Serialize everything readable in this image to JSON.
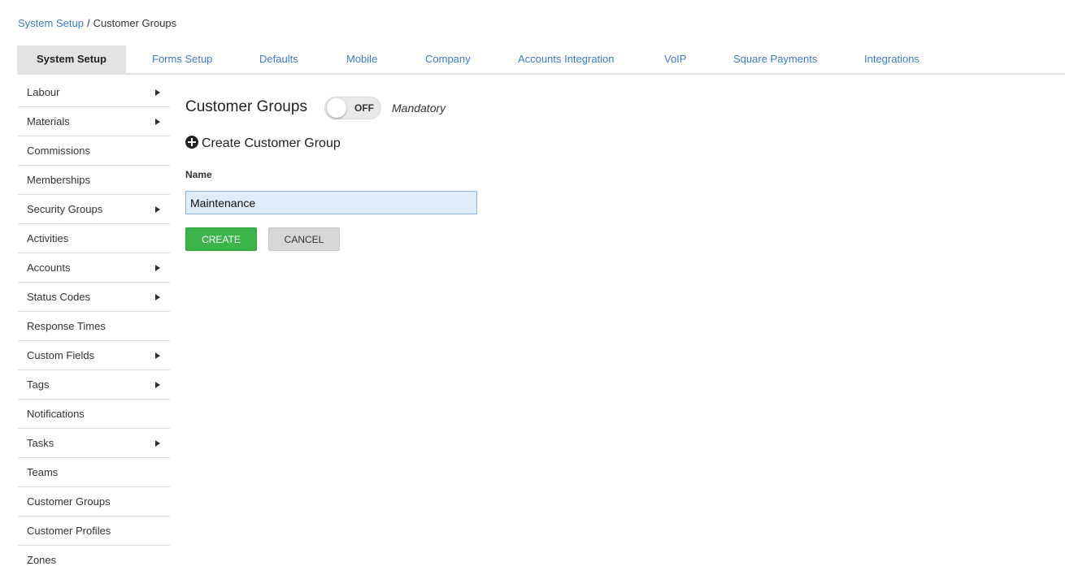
{
  "breadcrumb": {
    "parent": "System Setup",
    "separator": "/",
    "current": "Customer Groups"
  },
  "tabs": [
    {
      "label": "System Setup",
      "active": true
    },
    {
      "label": "Forms Setup"
    },
    {
      "label": "Defaults"
    },
    {
      "label": "Mobile"
    },
    {
      "label": "Company"
    },
    {
      "label": "Accounts Integration"
    },
    {
      "label": "VoIP"
    },
    {
      "label": "Square Payments"
    },
    {
      "label": "Integrations"
    }
  ],
  "sidebar": {
    "items": [
      {
        "label": "Labour",
        "has_submenu": true
      },
      {
        "label": "Materials",
        "has_submenu": true
      },
      {
        "label": "Commissions",
        "has_submenu": false
      },
      {
        "label": "Memberships",
        "has_submenu": false
      },
      {
        "label": "Security Groups",
        "has_submenu": true
      },
      {
        "label": "Activities",
        "has_submenu": false
      },
      {
        "label": "Accounts",
        "has_submenu": true
      },
      {
        "label": "Status Codes",
        "has_submenu": true
      },
      {
        "label": "Response Times",
        "has_submenu": false
      },
      {
        "label": "Custom Fields",
        "has_submenu": true
      },
      {
        "label": "Tags",
        "has_submenu": true
      },
      {
        "label": "Notifications",
        "has_submenu": false
      },
      {
        "label": "Tasks",
        "has_submenu": true
      },
      {
        "label": "Teams",
        "has_submenu": false
      },
      {
        "label": "Customer Groups",
        "has_submenu": false
      },
      {
        "label": "Customer Profiles",
        "has_submenu": false
      },
      {
        "label": "Zones",
        "has_submenu": false
      }
    ]
  },
  "main": {
    "title": "Customer Groups",
    "toggle": {
      "label": "OFF",
      "state": "off"
    },
    "mandatory_label": "Mandatory",
    "create_title": "Create Customer Group",
    "name_label": "Name",
    "name_value": "Maintenance",
    "create_button": "CREATE",
    "cancel_button": "CANCEL"
  },
  "colors": {
    "link": "#3a7bc8",
    "create_button": "#3bb54a",
    "cancel_button": "#d6d7d9",
    "input_background": "#deedfa"
  },
  "icons": {
    "create": "plus-circle-icon",
    "submenu": "caret-right-icon"
  }
}
